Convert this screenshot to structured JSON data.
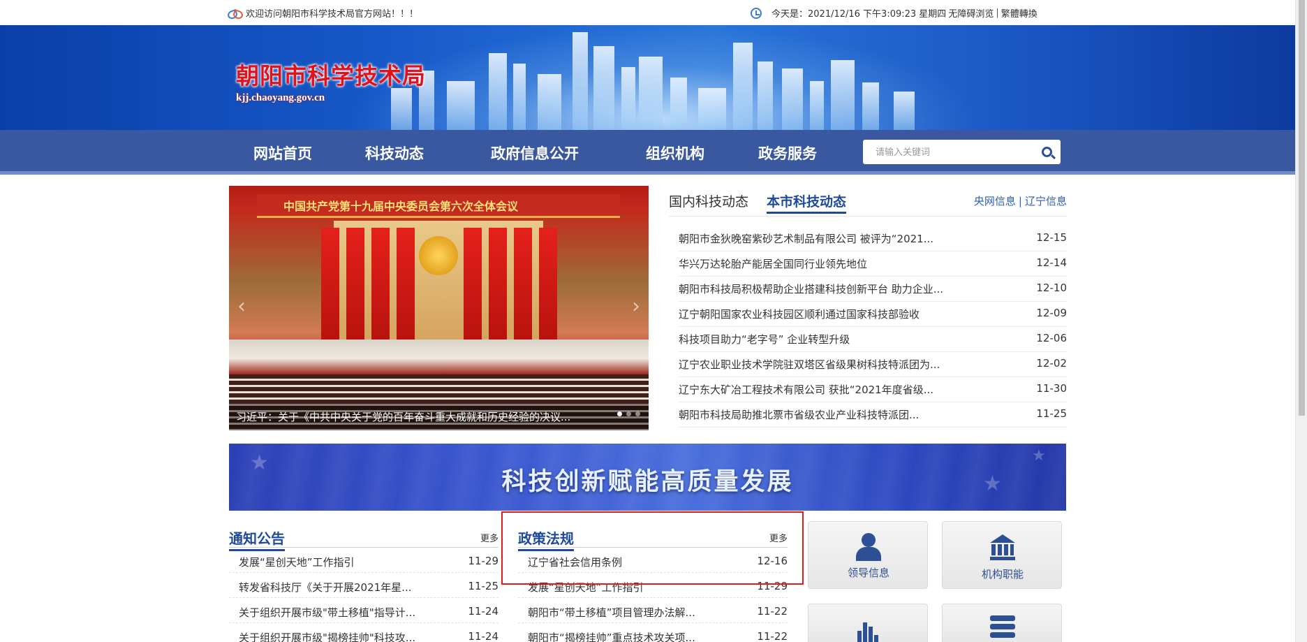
{
  "topbar": {
    "welcome": "欢迎访问朝阳市科学技术局官方网站！！！",
    "datetime": "今天是：2021/12/16 下午3:09:23 星期四",
    "accessible": "无障碍浏览",
    "divider": "|",
    "traditional": "繁體轉換"
  },
  "header": {
    "site_name": "朝阳市科学技术局",
    "domain": "kjj.chaoyang.gov.cn"
  },
  "nav": {
    "items": [
      "网站首页",
      "科技动态",
      "政府信息公开",
      "组织机构",
      "政务服务"
    ],
    "search_placeholder": "请输入关键词"
  },
  "slider": {
    "banner_text": "中国共产党第十九届中央委员会第六次全体会议",
    "caption": "习近平：关于《中共中央关于党的百年奋斗重大成就和历史经验的决议..."
  },
  "news": {
    "tab_domestic": "国内科技动态",
    "tab_local": "本市科技动态",
    "link_cctv": "央网信息",
    "link_sep": "|",
    "link_liaoning": "辽宁信息",
    "items": [
      {
        "title": "朝阳市金狄晚窑紫砂艺术制品有限公司 被评为“2021...",
        "date": "12-15"
      },
      {
        "title": "华兴万达轮胎产能居全国同行业领先地位",
        "date": "12-14"
      },
      {
        "title": "朝阳市科技局积极帮助企业搭建科技创新平台 助力企业...",
        "date": "12-10"
      },
      {
        "title": "辽宁朝阳国家农业科技园区顺利通过国家科技部验收",
        "date": "12-09"
      },
      {
        "title": "科技项目助力“老字号” 企业转型升级",
        "date": "12-06"
      },
      {
        "title": "辽宁农业职业技术学院驻双塔区省级果树科技特派团为...",
        "date": "12-02"
      },
      {
        "title": "辽宁东大矿冶工程技术有限公司 获批“2021年度省级...",
        "date": "11-30"
      },
      {
        "title": "朝阳市科技局助推北票市省级农业产业科技特派团...",
        "date": "11-25"
      }
    ]
  },
  "slogan": {
    "text": "科技创新赋能高质量发展"
  },
  "notices": {
    "title": "通知公告",
    "more": "更多",
    "items": [
      {
        "title": "发展“星创天地”工作指引",
        "date": "11-29"
      },
      {
        "title": "转发省科技厅《关于开展2021年星...",
        "date": "11-25"
      },
      {
        "title": "关于组织开展市级\"带土移植\"指导计...",
        "date": "11-24"
      },
      {
        "title": "关于组织开展市级\"揭榜挂帅\"科技攻...",
        "date": "11-24"
      }
    ]
  },
  "policies": {
    "title": "政策法规",
    "more": "更多",
    "items": [
      {
        "title": "辽宁省社会信用条例",
        "date": "12-16"
      },
      {
        "title": "发展“星创天地”工作指引",
        "date": "11-29"
      },
      {
        "title": "朝阳市“带土移植”项目管理办法解...",
        "date": "11-22"
      },
      {
        "title": "朝阳市“揭榜挂帅”重点技术攻关项...",
        "date": "11-22"
      }
    ]
  },
  "tiles": {
    "leaders": "领导信息",
    "functions": "机构职能"
  },
  "colors": {
    "brand_blue": "#39589f",
    "accent_blue": "#1f4a9c",
    "logo_red": "#e0121b",
    "highlight_red": "#e21b1b"
  },
  "icons": {
    "welcome": "handshake-icon",
    "time": "clock-icon",
    "search": "search-icon",
    "leaders": "person-icon",
    "functions": "building-icon",
    "stats": "bar-chart-icon",
    "services": "stack-icon"
  }
}
